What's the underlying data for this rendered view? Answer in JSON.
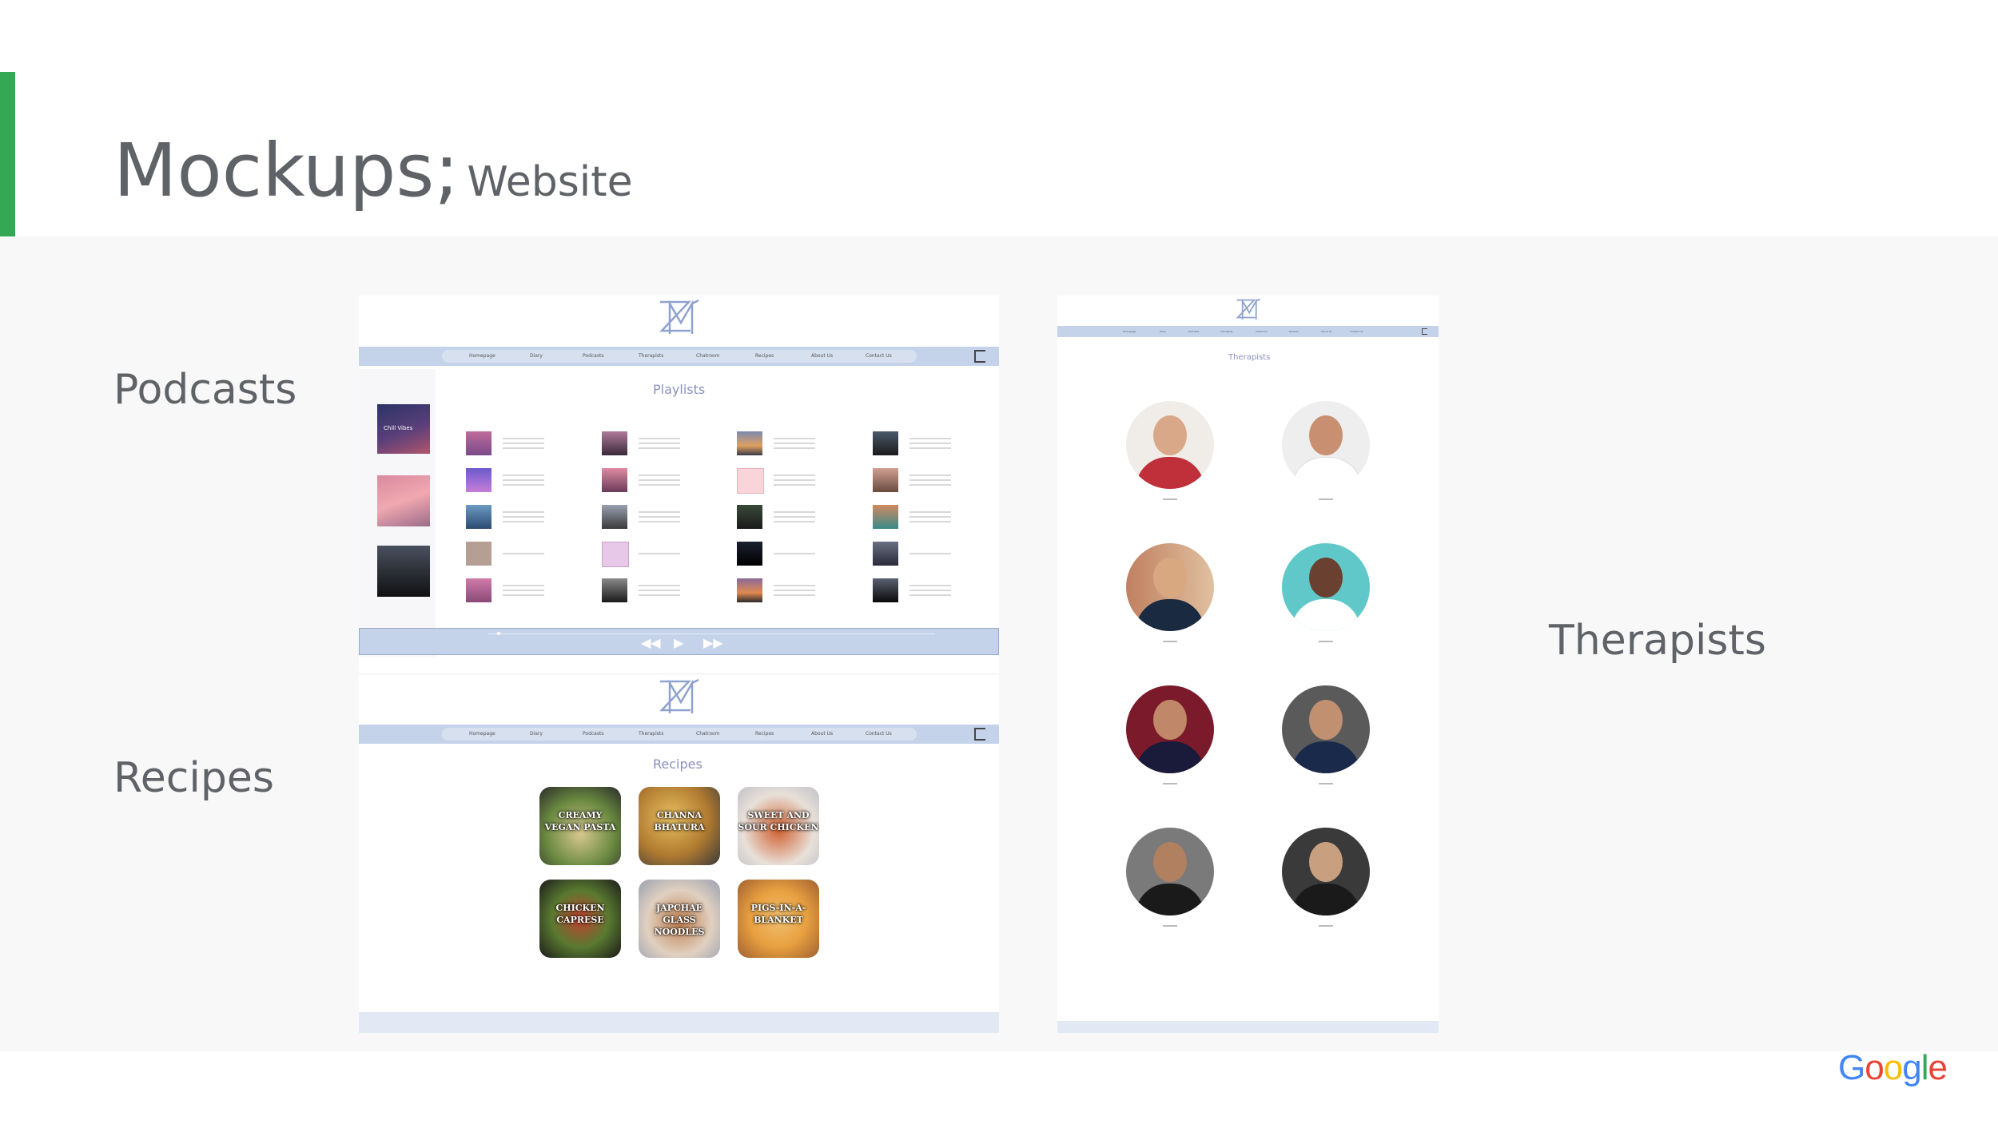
{
  "slide": {
    "title_main": "Mockups;",
    "title_sub": "Website",
    "label_podcasts": "Podcasts",
    "label_recipes": "Recipes",
    "label_therapists": "Therapists",
    "footer_brand": "Google",
    "accent_color": "#34a853"
  },
  "podcasts_mock": {
    "section_title": "Playlists",
    "nav_items": [
      "Homepage",
      "Diary",
      "Podcasts",
      "Therapists",
      "Chatroom",
      "Recipes",
      "About Us",
      "Contact Us"
    ],
    "featured_label": "Chill Vibes",
    "player_controls": [
      "previous-icon",
      "play-icon",
      "next-icon"
    ],
    "icons": [
      "logo-icon",
      "logout-icon"
    ]
  },
  "recipes_mock": {
    "section_title": "Recipes",
    "nav_items": [
      "Homepage",
      "Diary",
      "Podcasts",
      "Therapists",
      "Chatroom",
      "Recipes",
      "About Us",
      "Contact Us"
    ],
    "cards": [
      {
        "line1": "CREAMY",
        "line2": "VEGAN PASTA"
      },
      {
        "line1": "CHANNA",
        "line2": "BHATURA"
      },
      {
        "line1": "SWEET AND",
        "line2": "SOUR CHICKEN"
      },
      {
        "line1": "CHICKEN",
        "line2": "CAPRESE"
      },
      {
        "line1": "JAPCHAE GLASS",
        "line2": "NOODLES"
      },
      {
        "line1": "PIGS-IN-A-",
        "line2": "BLANKET"
      }
    ]
  },
  "therapists_mock": {
    "section_title": "Therapists",
    "nav_items": [
      "Homepage",
      "Diary",
      "Podcasts",
      "Therapists",
      "Chatroom",
      "Recipes",
      "About Us",
      "Contact Us"
    ]
  }
}
